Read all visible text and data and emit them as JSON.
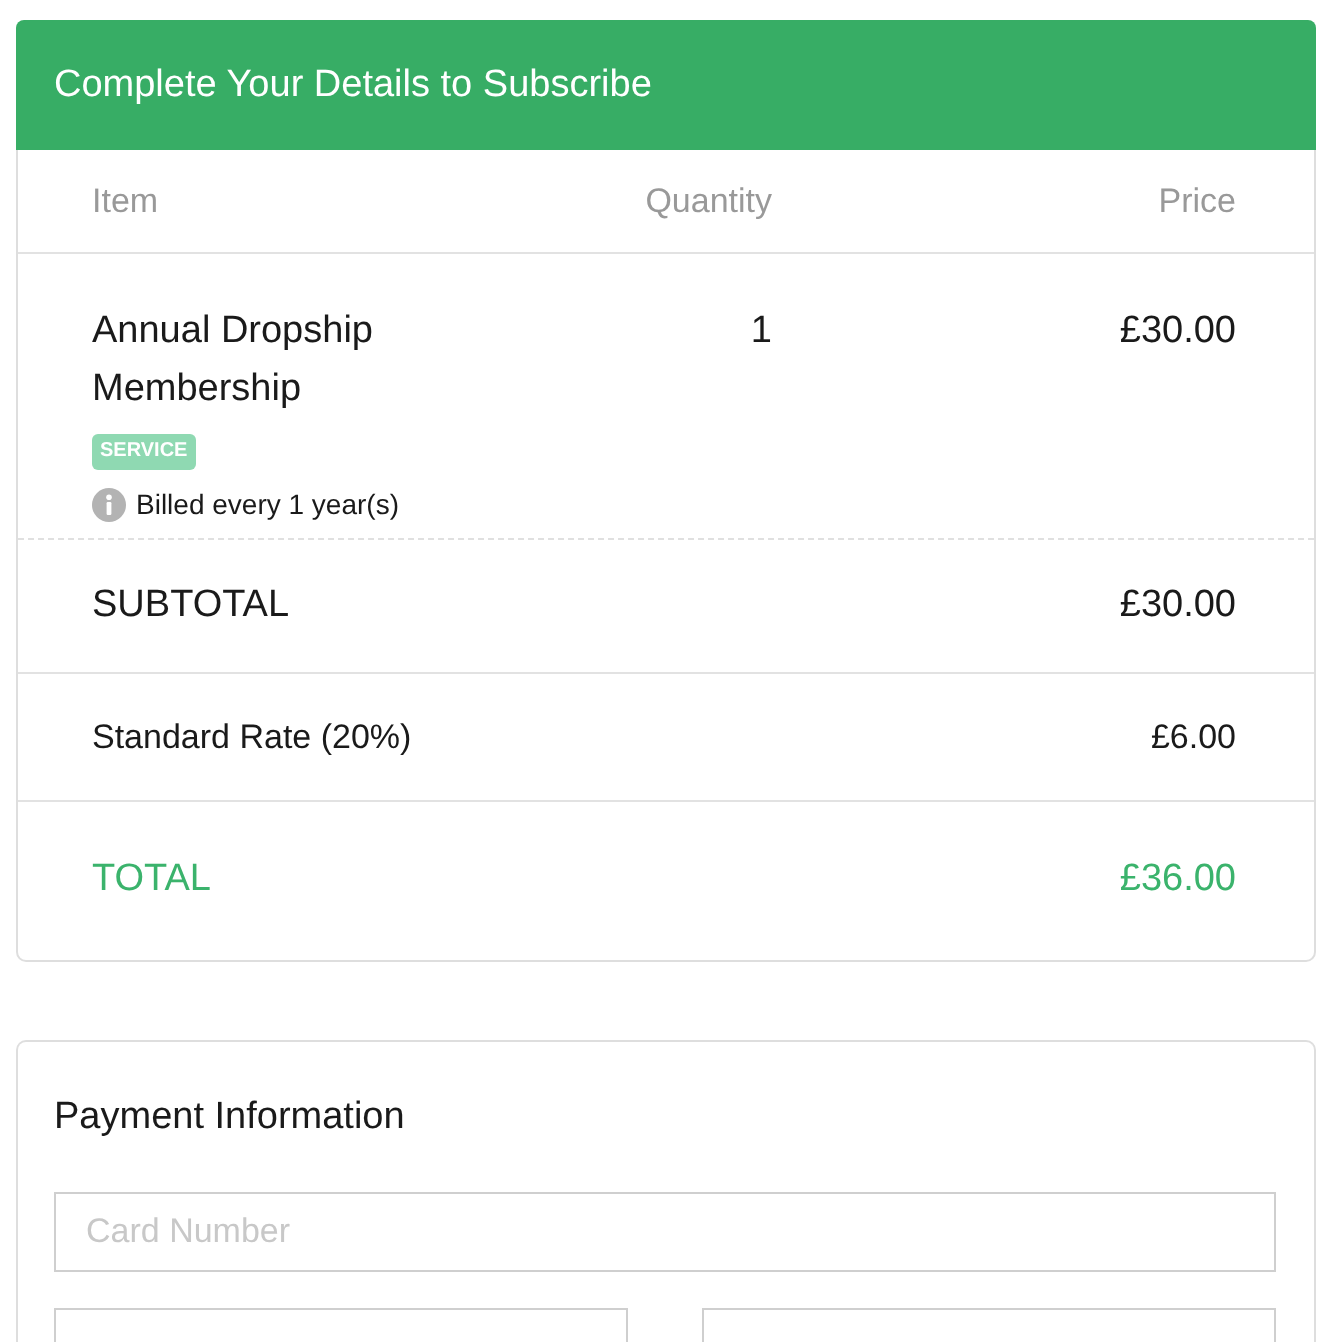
{
  "header": {
    "title": "Complete Your Details to Subscribe"
  },
  "order_table": {
    "columns": [
      "Item",
      "Quantity",
      "Price"
    ],
    "items": [
      {
        "name": "Annual Dropship Membership",
        "quantity": "1",
        "price": "£30.00",
        "tag": "SERVICE",
        "billing_note": "Billed every 1 year(s)"
      }
    ],
    "summary": [
      {
        "kind": "subtotal",
        "label": "SUBTOTAL",
        "amount": "£30.00"
      },
      {
        "kind": "tax",
        "label": "Standard Rate (20%)",
        "amount": "£6.00"
      },
      {
        "kind": "total",
        "label": "TOTAL",
        "amount": "£36.00"
      }
    ]
  },
  "payment": {
    "title": "Payment Information",
    "fields": [
      {
        "kind": "full",
        "placeholder": "Card Number"
      },
      {
        "kind": "half"
      },
      {
        "kind": "half"
      }
    ]
  }
}
